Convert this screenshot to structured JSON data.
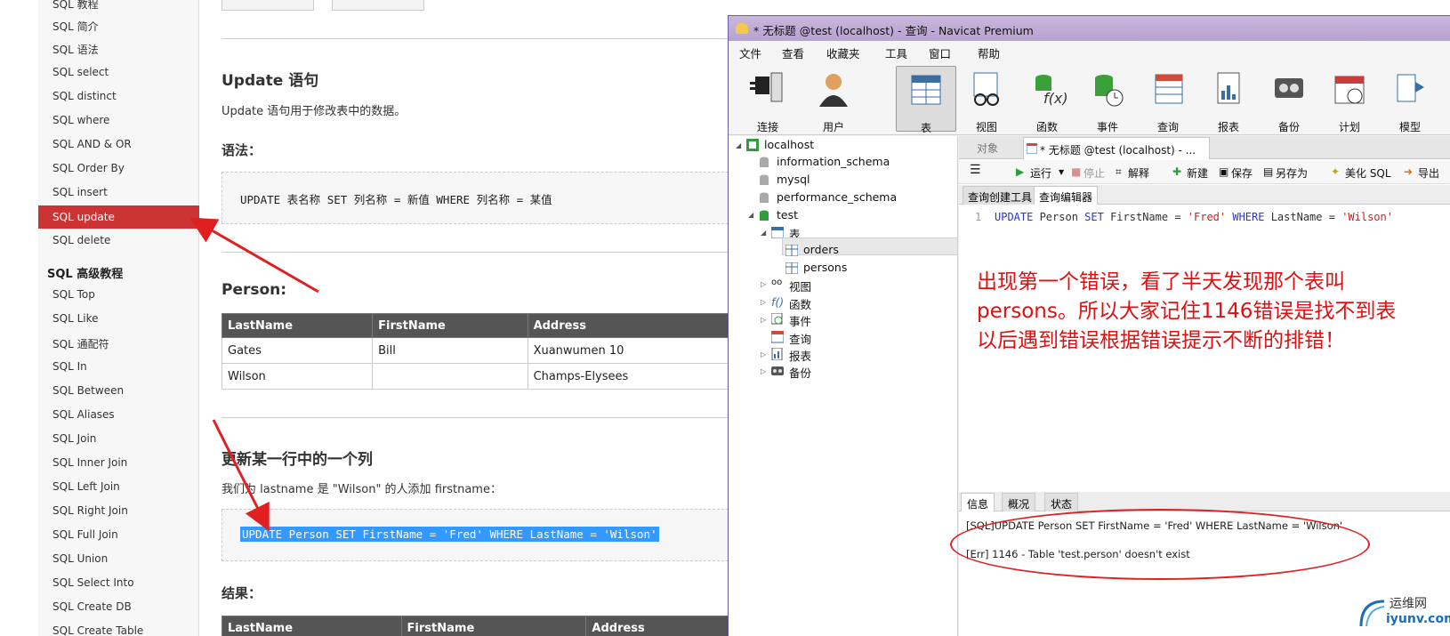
{
  "sidebar": {
    "items_top": [
      "SQL 教程",
      "SQL 简介",
      "SQL 语法",
      "SQL select",
      "SQL distinct",
      "SQL where",
      "SQL AND & OR",
      "SQL Order By",
      "SQL insert"
    ],
    "active_item": "SQL update",
    "item_after_active": "SQL delete",
    "advanced_heading": "SQL 高级教程",
    "items_advanced": [
      "SQL Top",
      "SQL Like",
      "SQL 通配符",
      "SQL In",
      "SQL Between",
      "SQL Aliases",
      "SQL Join",
      "SQL Inner Join",
      "SQL Left Join",
      "SQL Right Join",
      "SQL Full Join",
      "SQL Union",
      "SQL Select Into",
      "SQL Create DB",
      "SQL Create Table"
    ]
  },
  "article": {
    "section_title": "Update 语句",
    "section_desc": "Update 语句用于修改表中的数据。",
    "syntax_label": "语法：",
    "syntax_code": "UPDATE 表名称 SET 列名称 = 新值 WHERE 列名称 = 某值",
    "person_label": "Person:",
    "table_headers": [
      "LastName",
      "FirstName",
      "Address"
    ],
    "table_rows": [
      [
        "Gates",
        "Bill",
        "Xuanwumen 10"
      ],
      [
        "Wilson",
        "",
        "Champs-Elysees"
      ]
    ],
    "update_col_title": "更新某一行中的一个列",
    "update_col_desc": "我们为 lastname 是 \"Wilson\" 的人添加 firstname：",
    "update_col_code": "UPDATE Person SET FirstName = 'Fred' WHERE LastName = 'Wilson'",
    "result_label": "结果：",
    "result_headers": [
      "LastName",
      "FirstName",
      "Address"
    ]
  },
  "navicat": {
    "title": "* 无标题 @test (localhost) - 查询 - Navicat Premium",
    "menu": [
      "文件",
      "查看",
      "收藏夹",
      "工具",
      "窗口",
      "帮助"
    ],
    "toolbar": [
      "连接",
      "用户",
      "表",
      "视图",
      "函数",
      "事件",
      "查询",
      "报表",
      "备份",
      "计划",
      "模型"
    ],
    "tree": {
      "connection": "localhost",
      "databases": [
        "information_schema",
        "mysql",
        "performance_schema",
        "test"
      ],
      "tables_node": "表",
      "tables": [
        "orders",
        "persons"
      ],
      "other_nodes": [
        "视图",
        "函数",
        "事件",
        "查询",
        "报表",
        "备份"
      ]
    },
    "tabs": {
      "objects": "对象",
      "query_tab": "* 无标题 @test (localhost) - ..."
    },
    "query_toolbar": {
      "run": "运行",
      "stop": "停止",
      "explain": "解释",
      "new": "新建",
      "save": "保存",
      "save_as": "另存为",
      "beautify": "美化 SQL",
      "export": "导出"
    },
    "subtabs": [
      "查询创建工具",
      "查询编辑器"
    ],
    "editor": {
      "line_number": "1",
      "sql_kw1": "UPDATE",
      "sql_t1": " Person ",
      "sql_kw2": "SET",
      "sql_t2": " FirstName = ",
      "sql_s1": "'Fred'",
      "sql_t3": " ",
      "sql_kw3": "WHERE",
      "sql_t4": " LastName = ",
      "sql_s2": "'Wilson'"
    },
    "annotation_lines": [
      "出现第一个错误，看了半天发现那个表叫",
      "persons。所以大家记住1146错误是找不到表",
      "以后遇到错误根据错误提示不断的排错！"
    ],
    "bottom_tabs": [
      "信息",
      "概况",
      "状态"
    ],
    "messages": [
      "[SQL]UPDATE Person SET FirstName = 'Fred' WHERE LastName = 'Wilson'",
      "[Err] 1146 - Table 'test.person' doesn't exist"
    ]
  },
  "watermark": {
    "cn": "运维网",
    "en": "iyunv.com"
  },
  "colors": {
    "active_red": "#cc3333",
    "annotation_red": "#e01010",
    "titlebar": "#c9b6dd"
  }
}
